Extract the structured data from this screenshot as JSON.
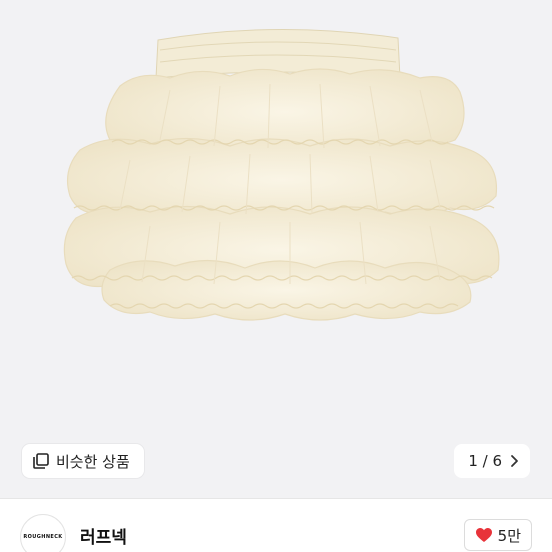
{
  "image_viewer": {
    "similar_label": "비슷한 상품",
    "current_page": "1",
    "separator": "/",
    "total_pages": "6",
    "page_text": "1 / 6"
  },
  "seller": {
    "avatar_text": "ROUGHNECK",
    "name": "러프넥"
  },
  "like": {
    "count": "5만"
  },
  "colors": {
    "background": "#f2f2f4",
    "skirt": "#f7f1df",
    "heart": "#e8333a"
  },
  "icons": {
    "similar": "copy-icon",
    "pager": "chevron-right-icon",
    "like": "heart-icon"
  }
}
